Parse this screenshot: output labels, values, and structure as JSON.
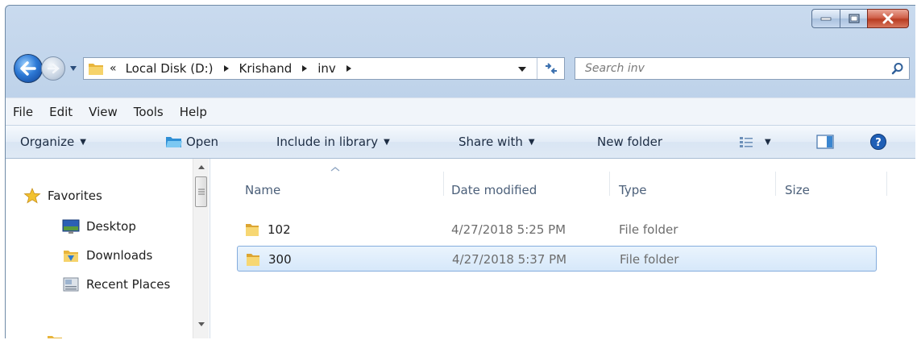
{
  "window": {
    "colors": {
      "frame": "#c4d7ec",
      "selection": "#d6e8fa",
      "close": "#c8452b"
    }
  },
  "caption": {
    "minimize_icon": "minimize-icon",
    "maximize_icon": "maximize-icon",
    "close_icon": "close-icon"
  },
  "address": {
    "overflow": "«",
    "breadcrumbs": [
      "Local Disk (D:)",
      "Krishand",
      "inv"
    ]
  },
  "search": {
    "placeholder": "Search inv"
  },
  "menu": [
    "File",
    "Edit",
    "View",
    "Tools",
    "Help"
  ],
  "commands": {
    "organize": "Organize",
    "open": "Open",
    "include": "Include in library",
    "share": "Share with",
    "new_folder": "New folder"
  },
  "nav": {
    "items": [
      "Favorites",
      "Desktop",
      "Downloads",
      "Recent Places"
    ]
  },
  "list": {
    "columns": [
      "Name",
      "Date modified",
      "Type",
      "Size"
    ],
    "rows": [
      {
        "name": "102",
        "date": "4/27/2018 5:25 PM",
        "type": "File folder",
        "size": ""
      },
      {
        "name": "300",
        "date": "4/27/2018 5:37 PM",
        "type": "File folder",
        "size": "",
        "selected": true
      }
    ]
  }
}
